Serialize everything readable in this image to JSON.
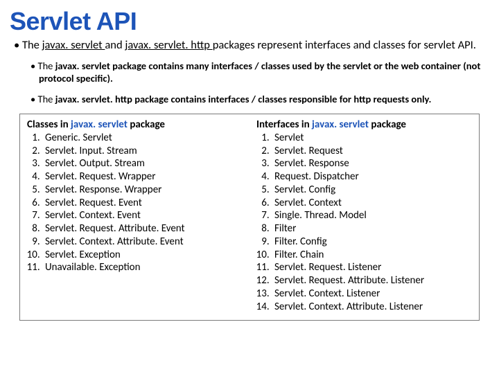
{
  "title": "Servlet API",
  "intro": {
    "pre": "The ",
    "u1": "javax. servlet ",
    "mid": "and ",
    "u2": "javax. servlet. http ",
    "post": "packages represent interfaces and classes for servlet API."
  },
  "sub1": {
    "pre": "The ",
    "bold": "javax. servlet ",
    "post": "package contains many interfaces / classes used by the servlet or the web container (not protocol specific)."
  },
  "sub2": {
    "pre": "The ",
    "bold": "javax. servlet. http ",
    "post": "package contains interfaces / classes responsible for http requests only."
  },
  "left": {
    "head_a": "Classes in ",
    "head_pkg": "javax. servlet ",
    "head_b": "package",
    "items": [
      "Generic. Servlet",
      "Servlet. Input. Stream",
      "Servlet. Output. Stream",
      "Servlet. Request. Wrapper",
      "Servlet. Response. Wrapper",
      "Servlet. Request. Event",
      "Servlet. Context. Event",
      "Servlet. Request. Attribute. Event",
      "Servlet. Context. Attribute. Event",
      "Servlet. Exception",
      "Unavailable. Exception"
    ]
  },
  "right": {
    "head_a": "Interfaces in ",
    "head_pkg": "javax. servlet ",
    "head_b": "package",
    "items": [
      "Servlet",
      "Servlet. Request",
      "Servlet. Response",
      "Request. Dispatcher",
      "Servlet. Config",
      "Servlet. Context",
      "Single. Thread. Model",
      "Filter",
      "Filter. Config",
      "Filter. Chain",
      "Servlet. Request. Listener",
      "Servlet. Request. Attribute. Listener",
      "Servlet. Context. Listener",
      "Servlet. Context. Attribute. Listener"
    ]
  }
}
